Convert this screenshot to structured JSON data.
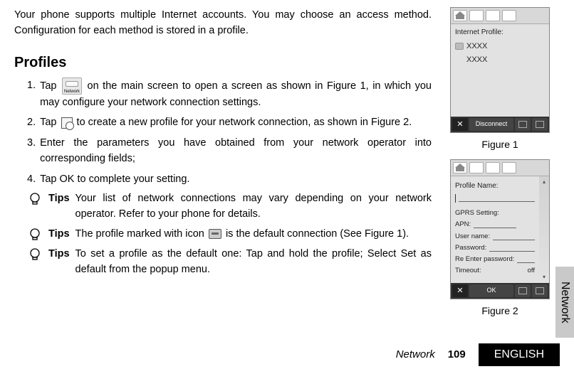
{
  "intro": "Your phone supports multiple Internet accounts. You may choose an access method. Configuration for each method is stored in a profile.",
  "section_heading": "Profiles",
  "icons": {
    "network_label": "Network"
  },
  "steps": [
    {
      "num": "1.",
      "pre": "Tap ",
      "post": " on the main screen to open a screen as shown in Figure 1, in which you may configure your network connection settings."
    },
    {
      "num": "2.",
      "pre": "Tap ",
      "post": " to create a new profile for your network connection, as shown in Figure 2."
    },
    {
      "num": "3.",
      "text": "Enter the parameters you have obtained from your network operator into corresponding fields;"
    },
    {
      "num": "4.",
      "text": "Tap OK to complete your setting."
    }
  ],
  "tips_label": "Tips",
  "tips": [
    {
      "body": "Your list of network connections may vary depending on your network operator. Refer to your phone for details."
    },
    {
      "body_pre": "The profile marked with icon ",
      "body_post": " is the default connection (See Figure 1)."
    },
    {
      "body": "To set a profile as the default one: Tap and hold the profile; Select Set as default from the popup menu."
    }
  ],
  "figures": {
    "fig1": "Figure 1",
    "fig2": "Figure 2"
  },
  "phone1": {
    "title": "Internet Profile:",
    "items": [
      "XXXX",
      "XXXX"
    ],
    "button": "Disconnect"
  },
  "phone2": {
    "title": "Profile Name:",
    "gprs": "GPRS Setting:",
    "apn": "APN:",
    "username": "User name:",
    "password": "Password:",
    "reenter": "Re Enter password:",
    "timeout": "Timeout:",
    "timeout_val": "off",
    "button": "OK"
  },
  "side_tab": "Network",
  "footer": {
    "title": "Network",
    "page": "109",
    "lang": "ENGLISH"
  }
}
